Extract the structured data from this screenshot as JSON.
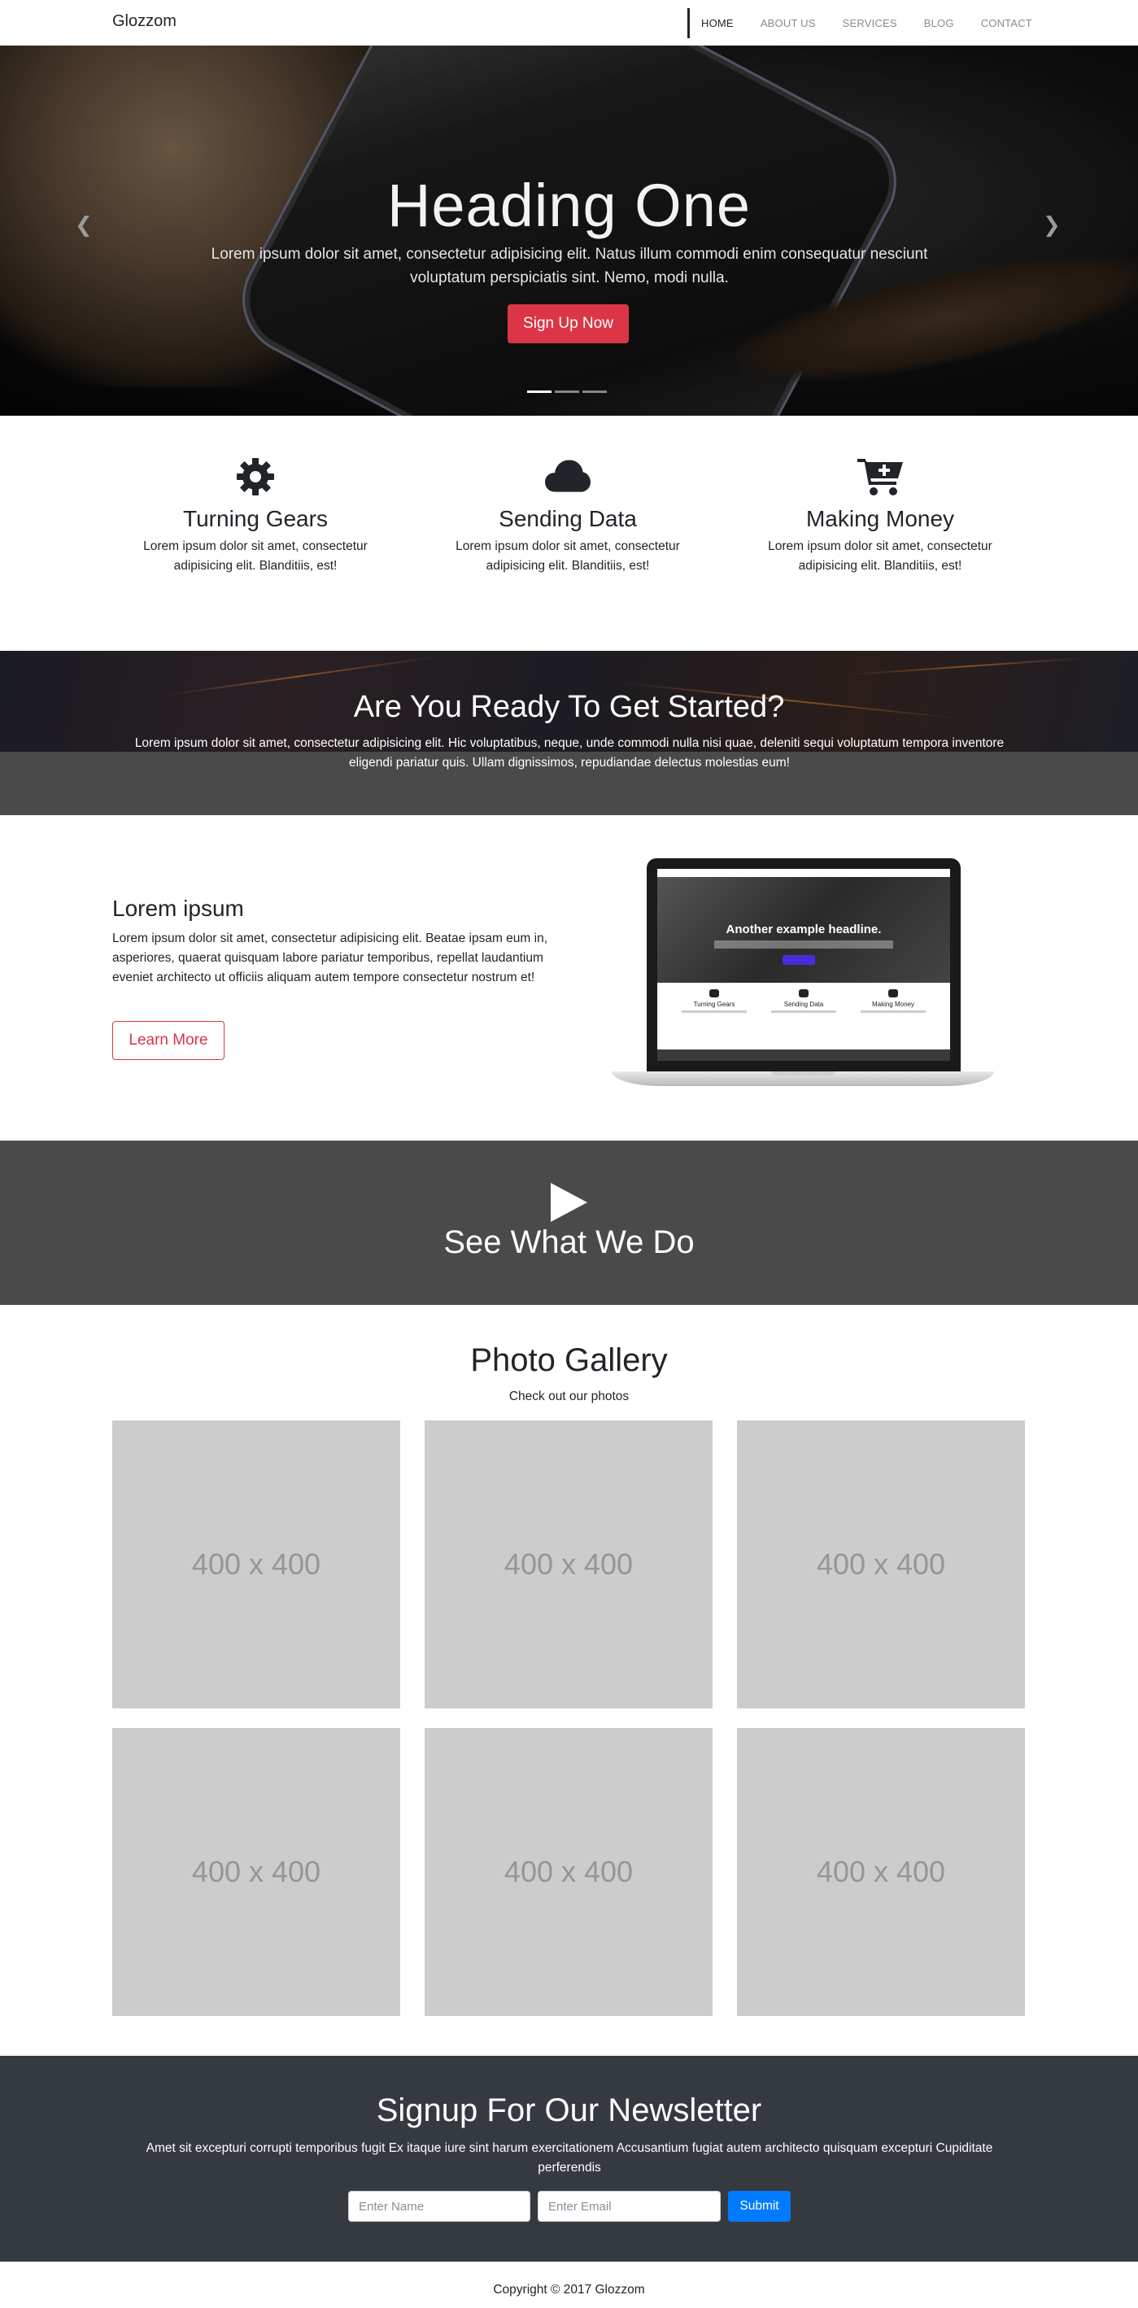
{
  "navbar": {
    "brand": "Glozzom",
    "links": [
      {
        "label": "HOME",
        "active": true
      },
      {
        "label": "ABOUT US",
        "active": false
      },
      {
        "label": "SERVICES",
        "active": false
      },
      {
        "label": "BLOG",
        "active": false
      },
      {
        "label": "CONTACT",
        "active": false
      }
    ]
  },
  "hero": {
    "title": "Heading One",
    "text": "Lorem ipsum dolor sit amet, consectetur adipisicing elit. Natus illum commodi enim consequatur nesciunt voluptatum perspiciatis sint. Nemo, modi nulla.",
    "button": "Sign Up Now",
    "prev_icon": "chevron-left-icon",
    "next_icon": "chevron-right-icon",
    "slides": 3,
    "active_slide": 1
  },
  "features": [
    {
      "icon": "gear-icon",
      "title": "Turning Gears",
      "text": "Lorem ipsum dolor sit amet, consectetur adipisicing elit. Blanditiis, est!"
    },
    {
      "icon": "cloud-icon",
      "title": "Sending Data",
      "text": "Lorem ipsum dolor sit amet, consectetur adipisicing elit. Blanditiis, est!"
    },
    {
      "icon": "cart-plus-icon",
      "title": "Making Money",
      "text": "Lorem ipsum dolor sit amet, consectetur adipisicing elit. Blanditiis, est!"
    }
  ],
  "cta": {
    "title": "Are You Ready To Get Started?",
    "text": "Lorem ipsum dolor sit amet, consectetur adipisicing elit. Hic voluptatibus, neque, unde commodi nulla nisi quae, deleniti sequi voluptatum tempora inventore eligendi pariatur quis. Ullam dignissimos, repudiandae delectus molestias eum!"
  },
  "info": {
    "title": "Lorem ipsum",
    "text": "Lorem ipsum dolor sit amet, consectetur adipisicing elit. Beatae ipsam eum in, asperiores, quaerat quisquam labore pariatur temporibus, repellat laudantium eveniet architecto ut officiis aliquam autem tempore consectetur nostrum et!",
    "button": "Learn More",
    "laptop_screen": {
      "headline": "Another example headline.",
      "features": [
        "Turning Gears",
        "Sending Data",
        "Making Money"
      ]
    }
  },
  "video": {
    "icon": "play-icon",
    "title": "See What We Do"
  },
  "gallery": {
    "title": "Photo Gallery",
    "subtitle": "Check out our photos",
    "tiles": [
      "400 x 400",
      "400 x 400",
      "400 x 400",
      "400 x 400",
      "400 x 400",
      "400 x 400"
    ]
  },
  "newsletter": {
    "title": "Signup For Our Newsletter",
    "text": "Amet sit excepturi corrupti temporibus fugit Ex itaque iure sint harum exercitationem Accusantium fugiat autem architecto quisquam excepturi Cupiditate perferendis",
    "name_placeholder": "Enter Name",
    "email_placeholder": "Enter Email",
    "submit": "Submit"
  },
  "footer": {
    "copyright": "Copyright © 2017 Glozzom"
  },
  "colors": {
    "danger": "#dc3545",
    "primary": "#007bff",
    "dark": "#343a40",
    "section_gray": "#4a4a4a",
    "placeholder_gray": "#cccccc"
  }
}
